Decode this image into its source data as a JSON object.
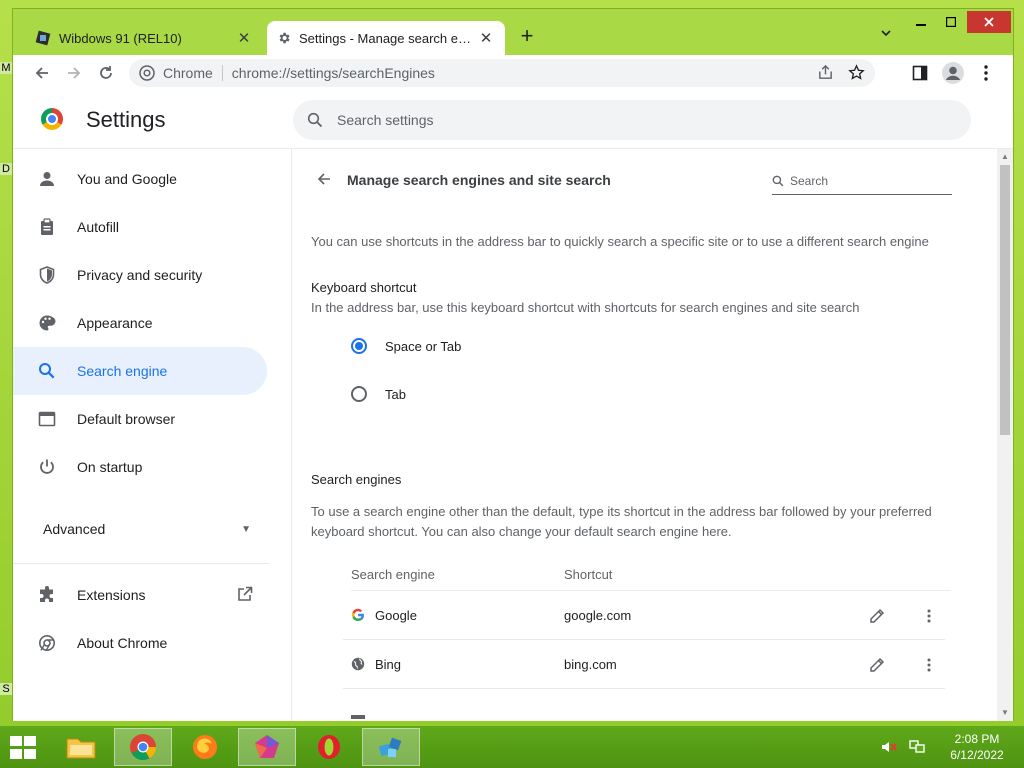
{
  "desktop": {
    "edge_letters": [
      "M",
      "D",
      "S"
    ]
  },
  "browser": {
    "tabs": [
      {
        "title": "Wibdows 91 (REL10)",
        "active": false
      },
      {
        "title": "Settings - Manage search engine",
        "active": true
      }
    ],
    "new_tab_label": "+",
    "omnibox": {
      "chip": "Chrome",
      "url_scheme": "chrome://",
      "url_path": "settings/searchEngines"
    }
  },
  "settings": {
    "title": "Settings",
    "search_placeholder": "Search settings",
    "nav": [
      {
        "label": "You and Google",
        "icon": "person-icon"
      },
      {
        "label": "Autofill",
        "icon": "clipboard-icon"
      },
      {
        "label": "Privacy and security",
        "icon": "shield-icon"
      },
      {
        "label": "Appearance",
        "icon": "palette-icon"
      },
      {
        "label": "Search engine",
        "icon": "search-icon",
        "active": true
      },
      {
        "label": "Default browser",
        "icon": "browser-icon"
      },
      {
        "label": "On startup",
        "icon": "power-icon"
      }
    ],
    "advanced_label": "Advanced",
    "extensions_label": "Extensions",
    "about_label": "About Chrome"
  },
  "main": {
    "page_title": "Manage search engines and site search",
    "search_placeholder": "Search",
    "intro": "You can use shortcuts in the address bar to quickly search a specific site or to use a different search engine",
    "keyboard_shortcut": {
      "heading": "Keyboard shortcut",
      "description": "In the address bar, use this keyboard shortcut with shortcuts for search engines and site search",
      "options": [
        {
          "label": "Space or Tab",
          "checked": true
        },
        {
          "label": "Tab",
          "checked": false
        }
      ]
    },
    "search_engines": {
      "heading": "Search engines",
      "description_line1": "To use a search engine other than the default, type its shortcut in the address bar followed by your preferred",
      "description_line2": "keyboard shortcut. You can also change your default search engine here.",
      "columns": [
        "Search engine",
        "Shortcut"
      ],
      "rows": [
        {
          "name": "Google",
          "shortcut": "google.com"
        },
        {
          "name": "Bing",
          "shortcut": "bing.com"
        }
      ]
    }
  },
  "taskbar": {
    "clock_time": "2:08 PM",
    "clock_date": "6/12/2022"
  },
  "colors": {
    "accent": "#1a73e8",
    "desktop": "#9fd832",
    "taskbar": "#5fa81a"
  }
}
